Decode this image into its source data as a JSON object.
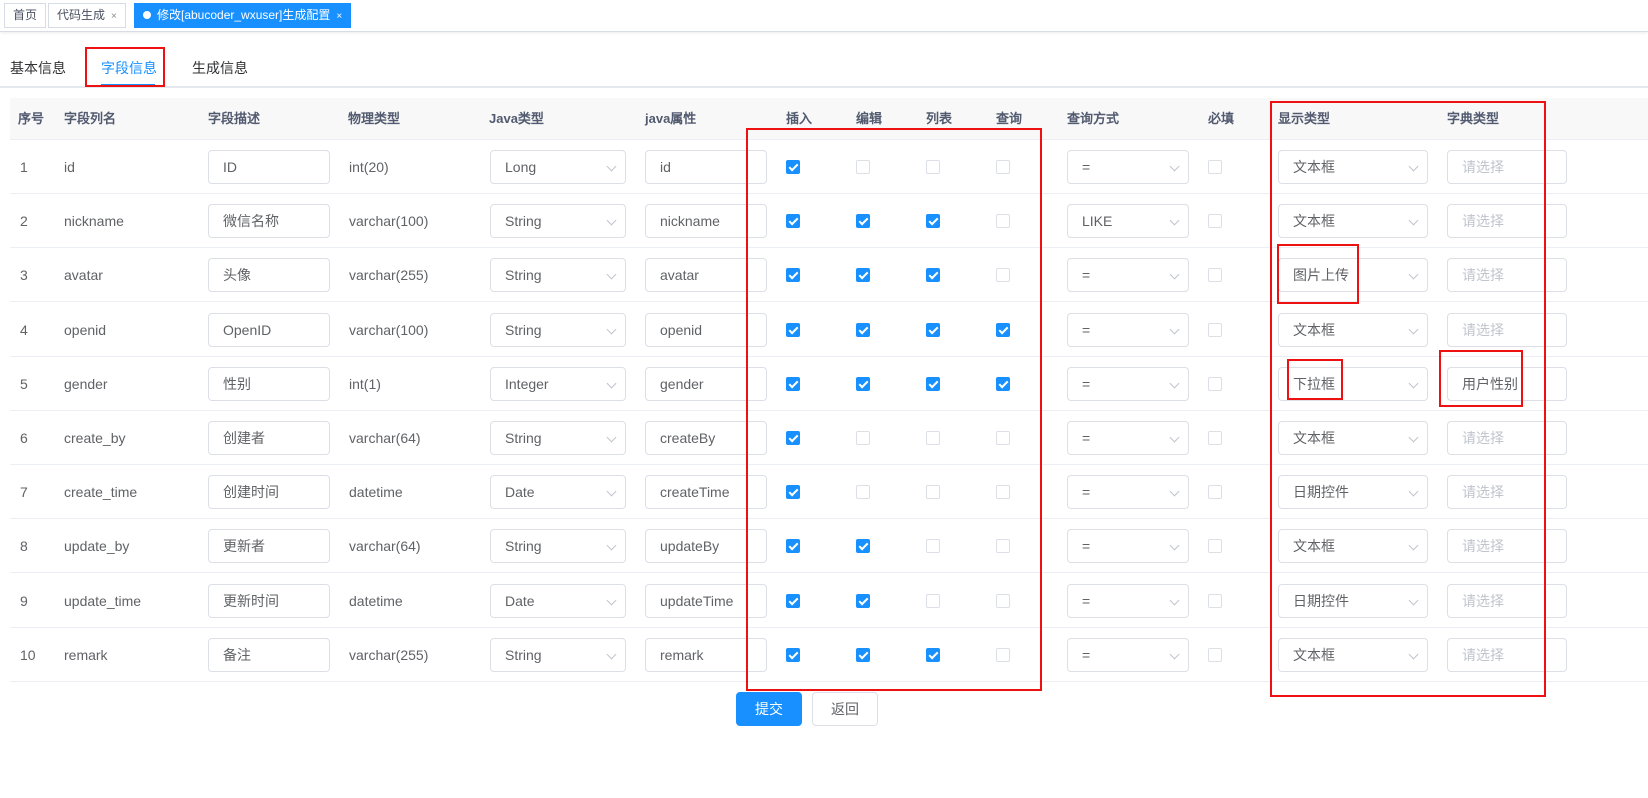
{
  "tags": [
    {
      "label": "首页",
      "closable": false,
      "active": false
    },
    {
      "label": "代码生成",
      "closable": true,
      "active": false
    },
    {
      "label": "修改[abucoder_wxuser]生成配置",
      "closable": true,
      "active": true
    }
  ],
  "tag_close_glyph": "×",
  "tabs": [
    {
      "label": "基本信息",
      "active": false
    },
    {
      "label": "字段信息",
      "active": true
    },
    {
      "label": "生成信息",
      "active": false
    }
  ],
  "columns": [
    "序号",
    "字段列名",
    "字段描述",
    "物理类型",
    "Java类型",
    "java属性",
    "插入",
    "编辑",
    "列表",
    "查询",
    "查询方式",
    "必填",
    "显示类型",
    "字典类型"
  ],
  "dict_placeholder": "请选择",
  "rows": [
    {
      "no": "1",
      "name": "id",
      "desc": "ID",
      "phys": "int(20)",
      "java_type": "Long",
      "java_prop": "id",
      "insert": true,
      "edit": false,
      "list": false,
      "query": false,
      "query_type": "=",
      "required": false,
      "html_type": "文本框",
      "dict": ""
    },
    {
      "no": "2",
      "name": "nickname",
      "desc": "微信名称",
      "phys": "varchar(100)",
      "java_type": "String",
      "java_prop": "nickname",
      "insert": true,
      "edit": true,
      "list": true,
      "query": false,
      "query_type": "LIKE",
      "required": false,
      "html_type": "文本框",
      "dict": ""
    },
    {
      "no": "3",
      "name": "avatar",
      "desc": "头像",
      "phys": "varchar(255)",
      "java_type": "String",
      "java_prop": "avatar",
      "insert": true,
      "edit": true,
      "list": true,
      "query": false,
      "query_type": "=",
      "required": false,
      "html_type": "图片上传",
      "dict": ""
    },
    {
      "no": "4",
      "name": "openid",
      "desc": "OpenID",
      "phys": "varchar(100)",
      "java_type": "String",
      "java_prop": "openid",
      "insert": true,
      "edit": true,
      "list": true,
      "query": true,
      "query_type": "=",
      "required": false,
      "html_type": "文本框",
      "dict": ""
    },
    {
      "no": "5",
      "name": "gender",
      "desc": "性别",
      "phys": "int(1)",
      "java_type": "Integer",
      "java_prop": "gender",
      "insert": true,
      "edit": true,
      "list": true,
      "query": true,
      "query_type": "=",
      "required": false,
      "html_type": "下拉框",
      "dict": "用户性别"
    },
    {
      "no": "6",
      "name": "create_by",
      "desc": "创建者",
      "phys": "varchar(64)",
      "java_type": "String",
      "java_prop": "createBy",
      "insert": true,
      "edit": false,
      "list": false,
      "query": false,
      "query_type": "=",
      "required": false,
      "html_type": "文本框",
      "dict": ""
    },
    {
      "no": "7",
      "name": "create_time",
      "desc": "创建时间",
      "phys": "datetime",
      "java_type": "Date",
      "java_prop": "createTime",
      "insert": true,
      "edit": false,
      "list": false,
      "query": false,
      "query_type": "=",
      "required": false,
      "html_type": "日期控件",
      "dict": ""
    },
    {
      "no": "8",
      "name": "update_by",
      "desc": "更新者",
      "phys": "varchar(64)",
      "java_type": "String",
      "java_prop": "updateBy",
      "insert": true,
      "edit": true,
      "list": false,
      "query": false,
      "query_type": "=",
      "required": false,
      "html_type": "文本框",
      "dict": ""
    },
    {
      "no": "9",
      "name": "update_time",
      "desc": "更新时间",
      "phys": "datetime",
      "java_type": "Date",
      "java_prop": "updateTime",
      "insert": true,
      "edit": true,
      "list": false,
      "query": false,
      "query_type": "=",
      "required": false,
      "html_type": "日期控件",
      "dict": ""
    },
    {
      "no": "10",
      "name": "remark",
      "desc": "备注",
      "phys": "varchar(255)",
      "java_type": "String",
      "java_prop": "remark",
      "insert": true,
      "edit": true,
      "list": true,
      "query": false,
      "query_type": "=",
      "required": false,
      "html_type": "文本框",
      "dict": ""
    }
  ],
  "buttons": {
    "submit": "提交",
    "back": "返回"
  },
  "colors": {
    "primary": "#1890ff",
    "annotation": "#ee1111"
  }
}
